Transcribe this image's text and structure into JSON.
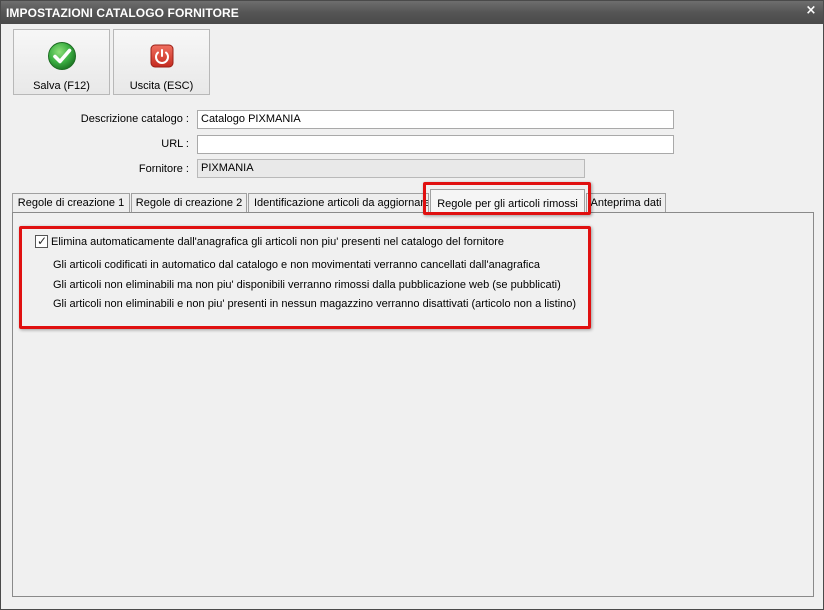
{
  "window": {
    "title": "IMPOSTAZIONI CATALOGO FORNITORE",
    "close_glyph": "×"
  },
  "toolbar": {
    "save_label": "Salva (F12)",
    "exit_label": "Uscita (ESC)",
    "save_icon": "check-icon",
    "exit_icon": "power-icon",
    "save_color": "#3cb043",
    "exit_color": "#d8352a"
  },
  "form": {
    "description_label": "Descrizione catalogo :",
    "description_value": "Catalogo PIXMANIA",
    "url_label": "URL :",
    "url_value": "",
    "supplier_label": "Fornitore :",
    "supplier_value": "PIXMANIA"
  },
  "tabs": [
    {
      "label": "Regole di creazione 1"
    },
    {
      "label": "Regole di creazione 2"
    },
    {
      "label": "Identificazione articoli da aggiornare"
    },
    {
      "label": "Regole per gli articoli rimossi",
      "active": true
    },
    {
      "label": "Anteprima dati"
    }
  ],
  "panel": {
    "checkbox_checked": true,
    "checkbox_label": "Elimina automaticamente dall'anagrafica gli articoli non piu' presenti nel catalogo del fornitore",
    "info_lines": [
      "Gli articoli codificati in automatico dal catalogo e non movimentati verranno cancellati dall'anagrafica",
      "Gli articoli non eliminabili ma non piu' disponibili verranno rimossi dalla pubblicazione web (se pubblicati)",
      "Gli articoli non eliminabili e non piu' presenti in nessun magazzino verranno disattivati (articolo non a listino)"
    ]
  },
  "highlight_color": "#e01010"
}
